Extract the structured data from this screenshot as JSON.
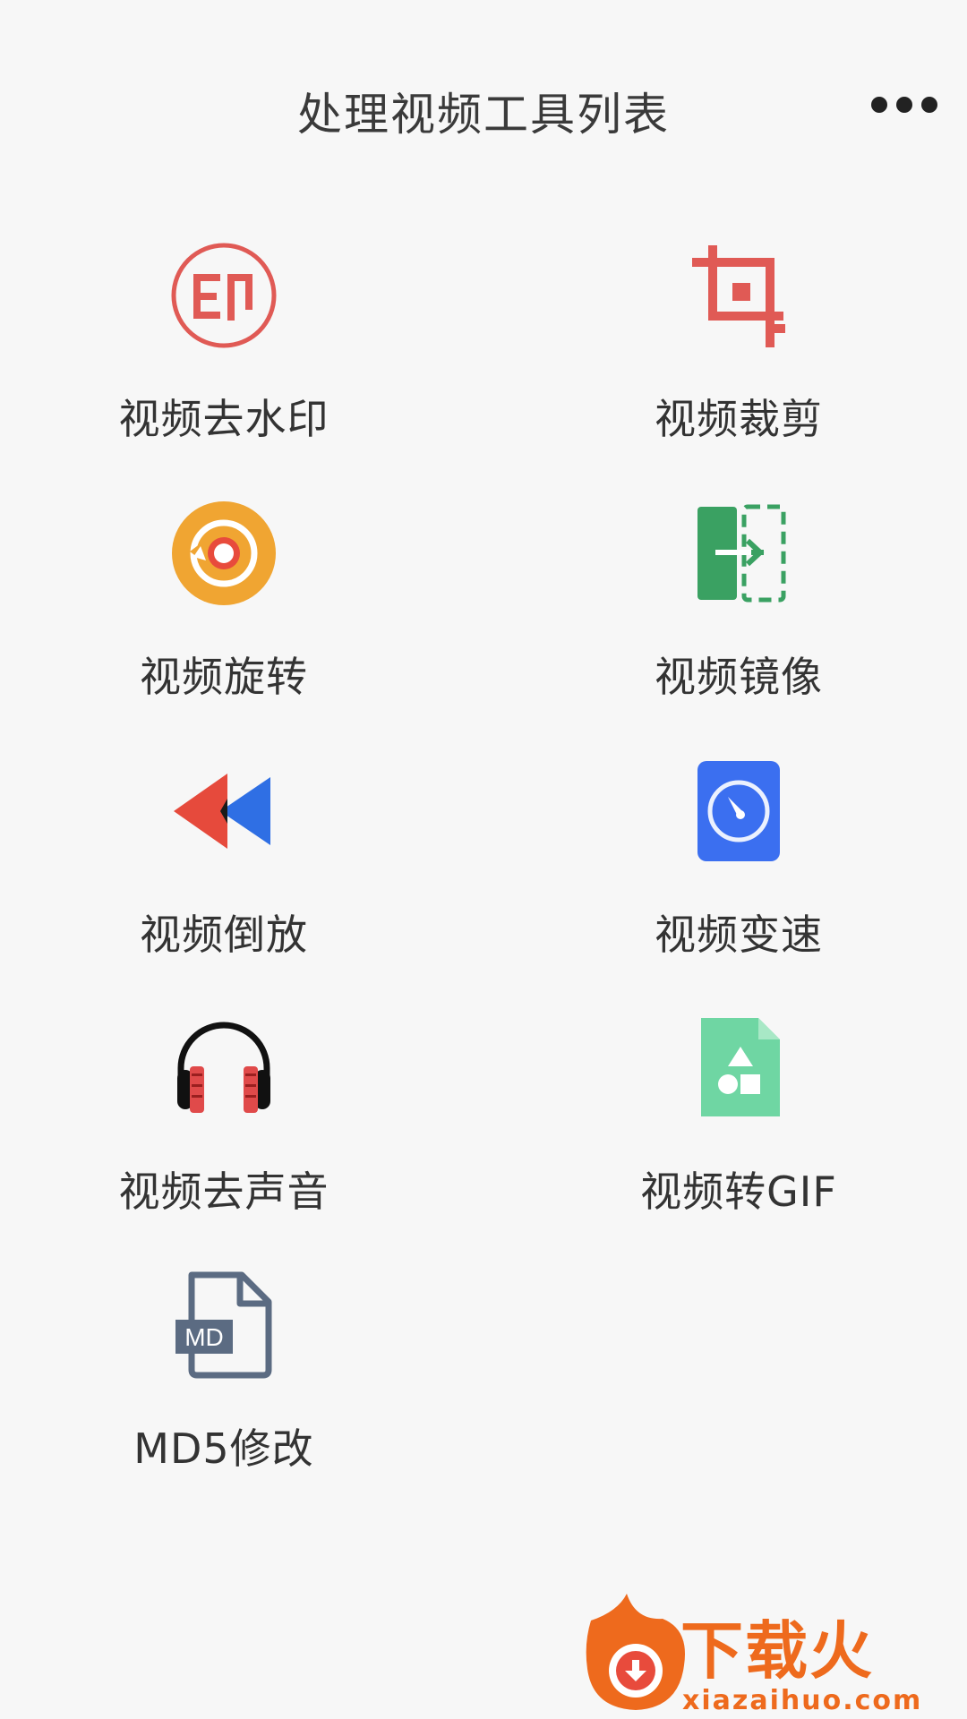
{
  "header": {
    "title": "处理视频工具列表",
    "more_icon": "more-horizontal-icon"
  },
  "tools": [
    {
      "label": "视频去水印",
      "icon": "watermark-stamp-icon",
      "color": "#e05a55"
    },
    {
      "label": "视频裁剪",
      "icon": "crop-icon",
      "color": "#e05a55"
    },
    {
      "label": "视频旋转",
      "icon": "rotate-icon",
      "color": "#f0a532"
    },
    {
      "label": "视频镜像",
      "icon": "mirror-icon",
      "color": "#3aa162"
    },
    {
      "label": "视频倒放",
      "icon": "rewind-icon",
      "color": "#2f6fe4"
    },
    {
      "label": "视频变速",
      "icon": "speedometer-icon",
      "color": "#3b6ff0"
    },
    {
      "label": "视频去声音",
      "icon": "headphones-icon",
      "color": "#e04a4a"
    },
    {
      "label": "视频转GIF",
      "icon": "gif-file-icon",
      "color": "#6fd6a3"
    },
    {
      "label": "MD5修改",
      "icon": "md-file-icon",
      "color": "#5b6b82"
    }
  ],
  "watermark": {
    "brand": "下载火",
    "domain": "xiazaihuo.com",
    "color": "#ee6a1d"
  }
}
